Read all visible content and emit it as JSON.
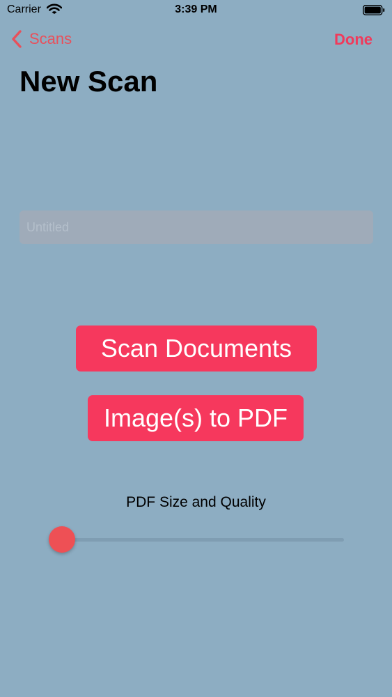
{
  "status_bar": {
    "carrier": "Carrier",
    "time": "3:39 PM"
  },
  "nav": {
    "back_label": "Scans",
    "done_label": "Done"
  },
  "page": {
    "title": "New Scan"
  },
  "name_field": {
    "placeholder": "Untitled",
    "value": ""
  },
  "actions": {
    "scan_documents_label": "Scan Documents",
    "images_to_pdf_label": "Image(s) to PDF"
  },
  "quality_slider": {
    "label": "PDF Size and Quality",
    "value": 0.04
  },
  "colors": {
    "background": "#8dadc2",
    "accent": "#f6385d",
    "nav_tint": "#e8505b",
    "slider_thumb": "#ee5055"
  },
  "icons": {
    "back": "chevron-left-icon",
    "wifi": "wifi-icon",
    "battery": "battery-icon"
  }
}
